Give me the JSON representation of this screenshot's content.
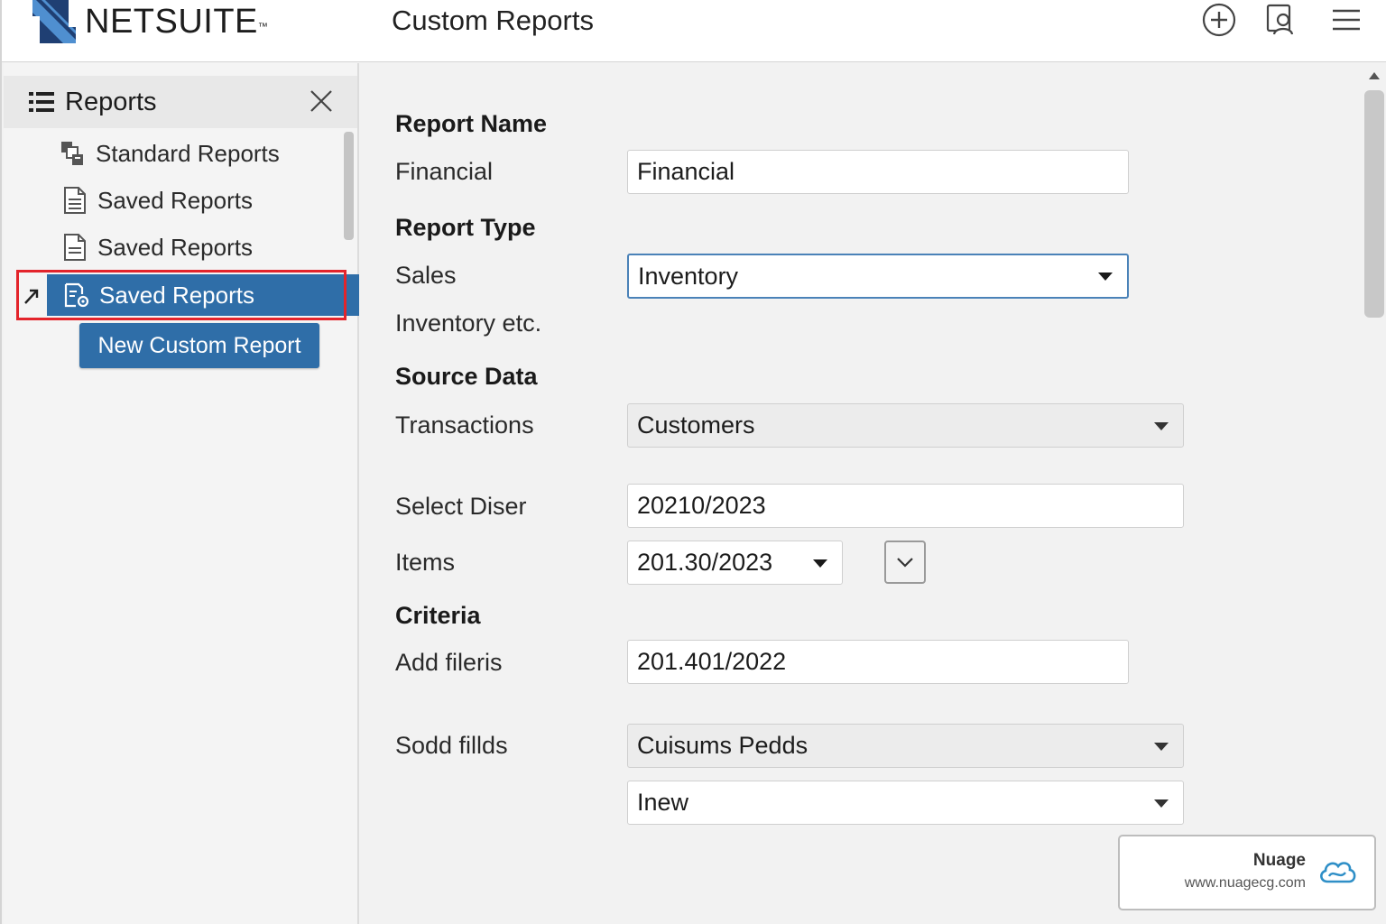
{
  "header": {
    "brand": "NETSUITE",
    "trademark": "™",
    "title": "Custom Reports",
    "icons": [
      "plus-circle-icon",
      "user-badge-icon",
      "hamburger-menu-icon"
    ]
  },
  "sidebar": {
    "title": "Reports",
    "items": [
      {
        "label": "Standard Reports",
        "icon": "standard-reports-icon"
      },
      {
        "label": "Saved Reports",
        "icon": "document-icon"
      },
      {
        "label": "Saved Reports",
        "icon": "document-icon"
      }
    ],
    "active_item": {
      "label": "Saved Reports",
      "icon": "saved-report-gear-icon"
    },
    "new_button": "New Custom Report",
    "accent_color": "#2f6ea8",
    "highlight_color": "#e3242b"
  },
  "form": {
    "report_name_heading": "Report Name",
    "financial_label": "Financial",
    "financial_value": "Financial",
    "report_type_heading": "Report Type",
    "sales_label": "Sales",
    "report_type_value": "Inventory",
    "inventory_etc_label": "Inventory etc.",
    "source_data_heading": "Source Data",
    "transactions_label": "Transactions",
    "transactions_value": "Customers",
    "select_diser_label": "Select Diser",
    "select_diser_value": "20210/2023",
    "items_label": "Items",
    "items_value": "201.30/2023",
    "criteria_heading": "Criteria",
    "add_fileris_label": "Add fileris",
    "add_fileris_value": "201.401/2022",
    "sodd_fillds_label": "Sodd fillds",
    "sodd_fillds_value": "Cuisums Pedds",
    "inew_value": "Inew"
  },
  "watermark": {
    "name": "Nuage",
    "url": "www.nuagecg.com"
  }
}
